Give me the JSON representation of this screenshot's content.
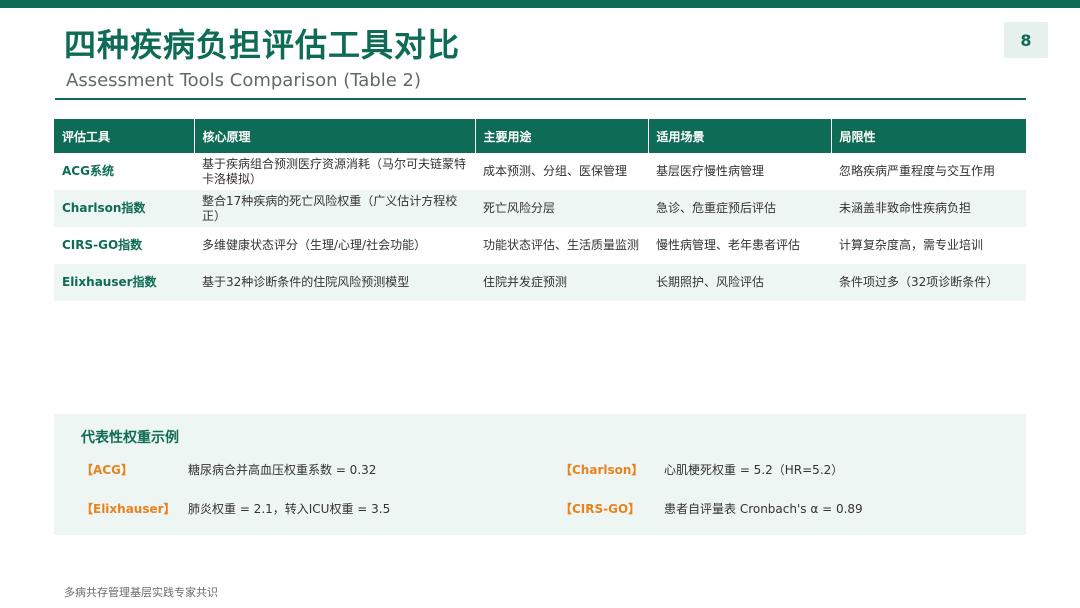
{
  "slide": {
    "title": "四种疾病负担评估工具对比",
    "subtitle": "Assessment Tools Comparison (Table 2)",
    "page_number": "8"
  },
  "colors": {
    "primary": "#0e6b55",
    "accent": "#e8821e",
    "row_alt": "#eef6f3",
    "panel": "#eef6f3"
  },
  "table": {
    "headers": [
      "评估工具",
      "核心原理",
      "主要用途",
      "适用场景",
      "局限性"
    ],
    "rows": [
      [
        "ACG系统",
        "基于疾病组合预测医疗资源消耗（马尔可夫链蒙特卡洛模拟）",
        "成本预测、分组、医保管理",
        "基层医疗慢性病管理",
        "忽略疾病严重程度与交互作用"
      ],
      [
        "Charlson指数",
        "整合17种疾病的死亡风险权重（广义估计方程校正）",
        "死亡风险分层",
        "急诊、危重症预后评估",
        "未涵盖非致命性疾病负担"
      ],
      [
        "CIRS-GO指数",
        "多维健康状态评分（生理/心理/社会功能）",
        "功能状态评估、生活质量监测",
        "慢性病管理、老年患者评估",
        "计算复杂度高，需专业培训"
      ],
      [
        "Elixhauser指数",
        "基于32种诊断条件的住院风险预测模型",
        "住院并发症预测",
        "长期照护、风险评估",
        "条件项过多（32项诊断条件）"
      ]
    ]
  },
  "examples": {
    "title": "代表性权重示例",
    "items": [
      {
        "tag": "【ACG】",
        "text": "糖尿病合并高血压权重系数 = 0.32"
      },
      {
        "tag": "【Charlson】",
        "text": "心肌梗死权重 = 5.2（HR=5.2）"
      },
      {
        "tag": "【Elixhauser】",
        "text": "肺炎权重 = 2.1，转入ICU权重 = 3.5"
      },
      {
        "tag": "【CIRS-GO】",
        "text": "患者自评量表 Cronbach's α = 0.89"
      }
    ]
  },
  "footer": {
    "text": "多病共存管理基层实践专家共识"
  }
}
